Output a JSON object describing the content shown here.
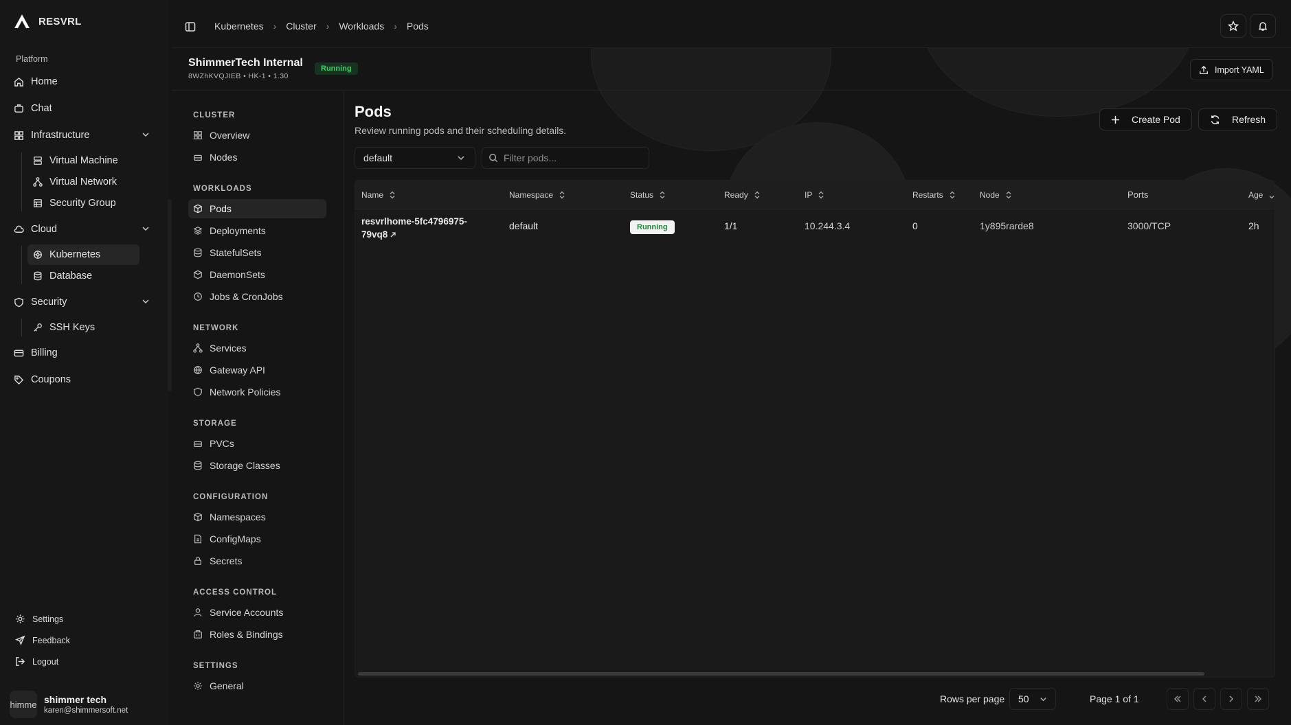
{
  "brand": {
    "name": "RESVRL"
  },
  "sidebar": {
    "section": "Platform",
    "items": [
      {
        "label": "Home",
        "icon": "home-icon"
      },
      {
        "label": "Chat",
        "icon": "chat-icon"
      },
      {
        "label": "Infrastructure",
        "icon": "grid-icon",
        "children": [
          "Virtual Machine",
          "Virtual Network",
          "Security Group"
        ]
      },
      {
        "label": "Cloud",
        "icon": "cloud-icon",
        "children": [
          "Kubernetes",
          "Database"
        ]
      },
      {
        "label": "Security",
        "icon": "shield-icon",
        "children": [
          "SSH Keys"
        ]
      },
      {
        "label": "Billing",
        "icon": "card-icon"
      },
      {
        "label": "Coupons",
        "icon": "tag-icon"
      }
    ],
    "footer": [
      "Settings",
      "Feedback",
      "Logout"
    ],
    "user": {
      "name": "shimmer tech",
      "email": "karen@shimmersoft.net",
      "avatar_text": "himme"
    }
  },
  "breadcrumb": [
    "Kubernetes",
    "Cluster",
    "Workloads",
    "Pods"
  ],
  "cluster": {
    "name": "ShimmerTech Internal",
    "meta": "8WZhKVQJIEB • HK-1 • 1.30",
    "status": "Running",
    "import_label": "Import YAML"
  },
  "subnav": {
    "groups": [
      {
        "title": "CLUSTER",
        "items": [
          "Overview",
          "Nodes"
        ]
      },
      {
        "title": "WORKLOADS",
        "items": [
          "Pods",
          "Deployments",
          "StatefulSets",
          "DaemonSets",
          "Jobs & CronJobs"
        ]
      },
      {
        "title": "NETWORK",
        "items": [
          "Services",
          "Gateway API",
          "Network Policies"
        ]
      },
      {
        "title": "STORAGE",
        "items": [
          "PVCs",
          "Storage Classes"
        ]
      },
      {
        "title": "CONFIGURATION",
        "items": [
          "Namespaces",
          "ConfigMaps",
          "Secrets"
        ]
      },
      {
        "title": "ACCESS CONTROL",
        "items": [
          "Service Accounts",
          "Roles & Bindings"
        ]
      },
      {
        "title": "SETTINGS",
        "items": [
          "General"
        ]
      }
    ]
  },
  "page": {
    "title": "Pods",
    "subtitle": "Review running pods and their scheduling details.",
    "create_label": "Create Pod",
    "refresh_label": "Refresh",
    "namespace": "default",
    "filter_placeholder": "Filter pods..."
  },
  "table": {
    "columns": [
      "Name",
      "Namespace",
      "Status",
      "Ready",
      "IP",
      "Restarts",
      "Node",
      "Ports",
      "Age"
    ],
    "rows": [
      {
        "name_line1": "resvrlhome-5fc4796975-",
        "name_line2": "79vq8",
        "namespace": "default",
        "status": "Running",
        "ready": "1/1",
        "ip": "10.244.3.4",
        "restarts": "0",
        "node": "1y895rarde8",
        "ports": "3000/TCP",
        "age": "2h"
      }
    ]
  },
  "pagination": {
    "rows_label": "Rows per page",
    "rows_value": "50",
    "page_label": "Page 1 of 1"
  },
  "colors": {
    "accent_green": "#39d064",
    "background": "#151515"
  }
}
